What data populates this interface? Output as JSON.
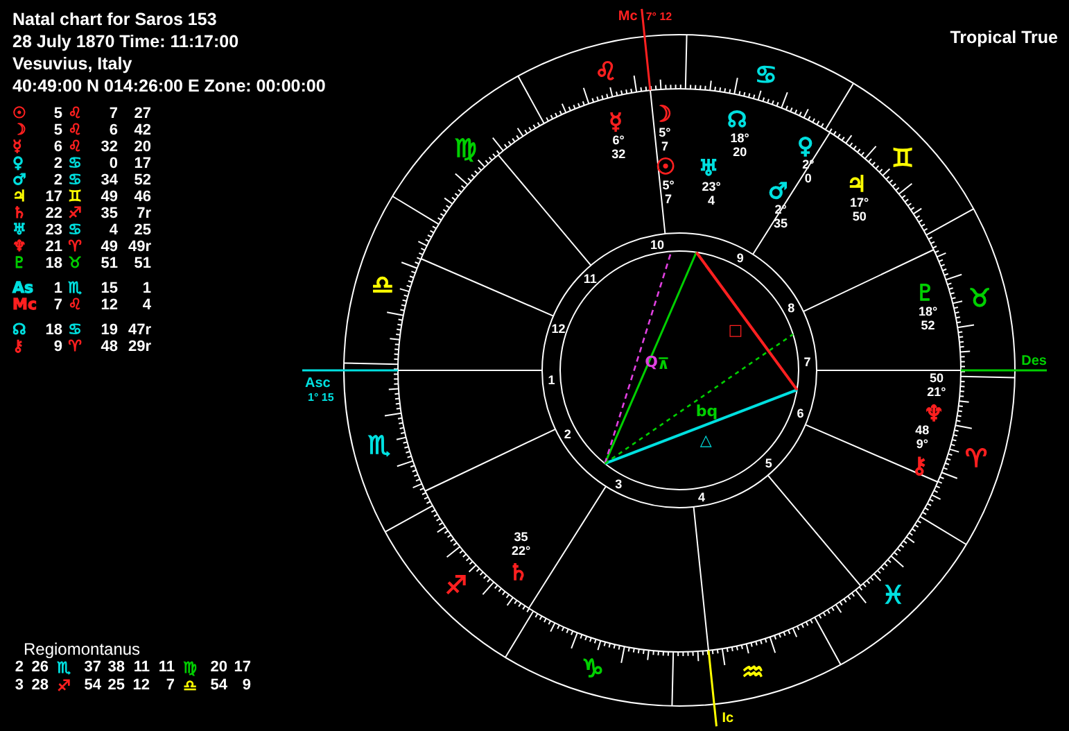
{
  "header": {
    "lines": [
      "Natal chart for Saros 153",
      "28 July 1870  Time: 11:17:00",
      "Vesuvius, Italy",
      "40:49:00 N 014:26:00 E Zone: 00:00:00"
    ]
  },
  "position_groups": [
    {
      "rows": [
        {
          "glyph": "☉",
          "color": "#ff2020",
          "deg": "5",
          "sign": {
            "glyph": "♌",
            "color": "#ff2020"
          },
          "min": "7",
          "sec": "27"
        },
        {
          "glyph": "☽",
          "color": "#ff2020",
          "deg": "5",
          "sign": {
            "glyph": "♌",
            "color": "#ff2020"
          },
          "min": "6",
          "sec": "42"
        },
        {
          "glyph": "☿",
          "color": "#ff2020",
          "deg": "6",
          "sign": {
            "glyph": "♌",
            "color": "#ff2020"
          },
          "min": "32",
          "sec": "20"
        },
        {
          "glyph": "♀",
          "color": "#00e0e0",
          "deg": "2",
          "sign": {
            "glyph": "♋",
            "color": "#00e0e0"
          },
          "min": "0",
          "sec": "17"
        },
        {
          "glyph": "♂",
          "color": "#00e0e0",
          "deg": "2",
          "sign": {
            "glyph": "♋",
            "color": "#00e0e0"
          },
          "min": "34",
          "sec": "52"
        },
        {
          "glyph": "♃",
          "color": "#ffff00",
          "deg": "17",
          "sign": {
            "glyph": "♊",
            "color": "#ffff00"
          },
          "min": "49",
          "sec": "46"
        },
        {
          "glyph": "♄",
          "color": "#ff2020",
          "deg": "22",
          "sign": {
            "glyph": "♐",
            "color": "#ff2020"
          },
          "min": "35",
          "sec": "7r"
        },
        {
          "glyph": "♅",
          "color": "#00e0e0",
          "deg": "23",
          "sign": {
            "glyph": "♋",
            "color": "#00e0e0"
          },
          "min": "4",
          "sec": "25"
        },
        {
          "glyph": "♆",
          "color": "#ff2020",
          "deg": "21",
          "sign": {
            "glyph": "♈",
            "color": "#ff2020"
          },
          "min": "49",
          "sec": "49r"
        },
        {
          "glyph": "♇",
          "color": "#00d000",
          "deg": "18",
          "sign": {
            "glyph": "♉",
            "color": "#00d000"
          },
          "min": "51",
          "sec": "51"
        }
      ]
    },
    {
      "rows": [
        {
          "glyph": "As",
          "color": "#00e0e0",
          "deg": "1",
          "sign": {
            "glyph": "♏",
            "color": "#00e0e0"
          },
          "min": "15",
          "sec": "1"
        },
        {
          "glyph": "Mc",
          "color": "#ff2020",
          "deg": "7",
          "sign": {
            "glyph": "♌",
            "color": "#ff2020"
          },
          "min": "12",
          "sec": "4"
        }
      ]
    },
    {
      "rows": [
        {
          "glyph": "☊",
          "color": "#00e0e0",
          "deg": "18",
          "sign": {
            "glyph": "♋",
            "color": "#00e0e0"
          },
          "min": "19",
          "sec": "47r"
        },
        {
          "glyph": "⚷",
          "color": "#ff2020",
          "deg": "9",
          "sign": {
            "glyph": "♈",
            "color": "#ff2020"
          },
          "min": "48",
          "sec": "29r"
        }
      ]
    }
  ],
  "houses": {
    "title": "Regiomontanus",
    "rows": [
      {
        "cells": [
          {
            "house": "2",
            "deg": "26",
            "sign": {
              "glyph": "♏",
              "color": "#00e0e0"
            },
            "min": "37",
            "sec": "38"
          },
          {
            "house": "11",
            "deg": "11",
            "sign": {
              "glyph": "♍",
              "color": "#00d000"
            },
            "min": "20",
            "sec": "17"
          }
        ]
      },
      {
        "cells": [
          {
            "house": "3",
            "deg": "28",
            "sign": {
              "glyph": "♐",
              "color": "#ff2020"
            },
            "min": "54",
            "sec": "25"
          },
          {
            "house": "12",
            "deg": "7",
            "sign": {
              "glyph": "♎",
              "color": "#ffff00"
            },
            "min": "54",
            "sec": "9"
          }
        ]
      }
    ]
  },
  "system": "Tropical True",
  "chart": {
    "zodiac": [
      {
        "glyph": "♈",
        "color": "#ff2020"
      },
      {
        "glyph": "♉",
        "color": "#00d000"
      },
      {
        "glyph": "♊",
        "color": "#ffff00"
      },
      {
        "glyph": "♋",
        "color": "#00e0e0"
      },
      {
        "glyph": "♌",
        "color": "#ff2020"
      },
      {
        "glyph": "♍",
        "color": "#00d000"
      },
      {
        "glyph": "♎",
        "color": "#ffff00"
      },
      {
        "glyph": "♏",
        "color": "#00e0e0"
      },
      {
        "glyph": "♐",
        "color": "#ff2020"
      },
      {
        "glyph": "♑",
        "color": "#00d000"
      },
      {
        "glyph": "♒",
        "color": "#ffff00"
      },
      {
        "glyph": "♓",
        "color": "#00e0e0"
      }
    ],
    "cusps": [
      {
        "label": "1"
      },
      {
        "label": "2"
      },
      {
        "label": "3"
      },
      {
        "label": "4"
      },
      {
        "label": "5"
      },
      {
        "label": "6"
      },
      {
        "label": "7"
      },
      {
        "label": "8"
      },
      {
        "label": "9"
      },
      {
        "label": "10"
      },
      {
        "label": "11"
      },
      {
        "label": "12"
      }
    ],
    "angles": [
      {
        "kind": "asc",
        "label": "Asc",
        "detail": "1° 15",
        "color": "#00e0e0"
      },
      {
        "kind": "mc",
        "label": "Mc",
        "detail": "7° 12",
        "color": "#ff2020"
      },
      {
        "kind": "dsc",
        "label": "Des",
        "color": "#00d000"
      },
      {
        "kind": "ic",
        "label": "Ic",
        "color": "#ffff00"
      }
    ],
    "planets": [
      {
        "glyph": "☽",
        "deg": "5°",
        "min": "7",
        "color": "#ff2020"
      },
      {
        "glyph": "☉",
        "deg": "5°",
        "min": "7",
        "color": "#ff2020"
      },
      {
        "glyph": "☿",
        "deg": "6°",
        "min": "32",
        "color": "#ff2020"
      },
      {
        "glyph": "♀",
        "deg": "2°",
        "min": "0",
        "color": "#00e0e0"
      },
      {
        "glyph": "♂",
        "deg": "2°",
        "min": "35",
        "color": "#00e0e0"
      },
      {
        "glyph": "♃",
        "deg": "17°",
        "min": "50",
        "color": "#ffff00"
      },
      {
        "glyph": "♄",
        "deg": "22°",
        "min": "35",
        "color": "#ff2020"
      },
      {
        "glyph": "♅",
        "deg": "23°",
        "min": "4",
        "color": "#00e0e0"
      },
      {
        "glyph": "♆",
        "deg": "21°",
        "min": "50",
        "color": "#ff2020"
      },
      {
        "glyph": "♇",
        "deg": "18°",
        "min": "52",
        "color": "#00d000"
      },
      {
        "glyph": "☊",
        "deg": "18°",
        "min": "20",
        "color": "#00e0e0"
      },
      {
        "glyph": "⚷",
        "deg": "9°",
        "min": "48",
        "color": "#ff2020"
      }
    ],
    "aspects": [
      {
        "kind": "trine",
        "symbol": "△"
      },
      {
        "kind": "quincunx",
        "symbol": "⊼"
      },
      {
        "kind": "square",
        "symbol": "□"
      },
      {
        "kind": "sesquiquadrate",
        "symbol": "Q"
      },
      {
        "kind": "biquintile",
        "symbol": "bq"
      }
    ]
  }
}
